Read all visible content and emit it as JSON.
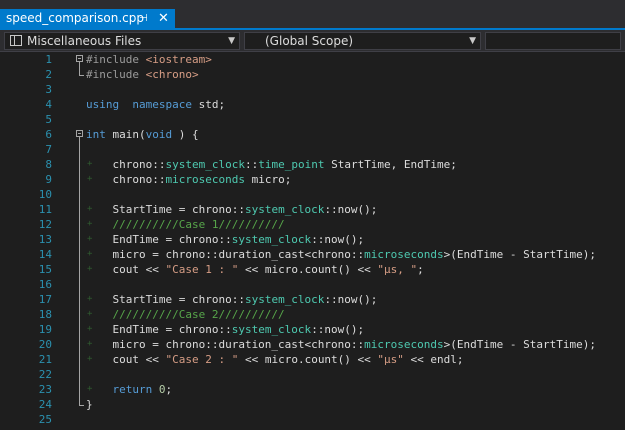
{
  "tab": {
    "title": "speed_comparison.cpp",
    "pin_glyph": "⊣",
    "close_glyph": "✕"
  },
  "nav": {
    "files": "Miscellaneous Files",
    "scope": "(Global Scope)",
    "third": ""
  },
  "code": {
    "lines": [
      {
        "n": "1",
        "segs": [
          [
            "pp",
            "#include "
          ],
          [
            "inc",
            "<iostream>"
          ]
        ]
      },
      {
        "n": "2",
        "segs": [
          [
            "pp",
            "#include "
          ],
          [
            "inc",
            "<chrono>"
          ]
        ]
      },
      {
        "n": "3",
        "segs": []
      },
      {
        "n": "4",
        "segs": [
          [
            "kw",
            "using"
          ],
          [
            "",
            "  "
          ],
          [
            "kw",
            "namespace"
          ],
          [
            "",
            " std;"
          ]
        ]
      },
      {
        "n": "5",
        "segs": []
      },
      {
        "n": "6",
        "segs": [
          [
            "kw",
            "int"
          ],
          [
            "",
            " main("
          ],
          [
            "kw",
            "void"
          ],
          [
            "",
            " ) {"
          ]
        ]
      },
      {
        "n": "7",
        "segs": []
      },
      {
        "n": "8",
        "segs": [
          [
            "",
            "    chrono::"
          ],
          [
            "ty",
            "system_clock"
          ],
          [
            "",
            "::"
          ],
          [
            "ty",
            "time_point"
          ],
          [
            "",
            " StartTime, EndTime;"
          ]
        ]
      },
      {
        "n": "9",
        "segs": [
          [
            "",
            "    chrono::"
          ],
          [
            "ty",
            "microseconds"
          ],
          [
            "",
            " micro;"
          ]
        ]
      },
      {
        "n": "10",
        "segs": []
      },
      {
        "n": "11",
        "segs": [
          [
            "",
            "    StartTime = chrono::"
          ],
          [
            "ty",
            "system_clock"
          ],
          [
            "",
            "::now();"
          ]
        ]
      },
      {
        "n": "12",
        "segs": [
          [
            "cm",
            "    //////////Case 1//////////"
          ]
        ]
      },
      {
        "n": "13",
        "segs": [
          [
            "",
            "    EndTime = chrono::"
          ],
          [
            "ty",
            "system_clock"
          ],
          [
            "",
            "::now();"
          ]
        ]
      },
      {
        "n": "14",
        "segs": [
          [
            "",
            "    micro = chrono::duration_cast<chrono::"
          ],
          [
            "ty",
            "microseconds"
          ],
          [
            "",
            ">(EndTime - StartTime);"
          ]
        ]
      },
      {
        "n": "15",
        "segs": [
          [
            "",
            "    cout << "
          ],
          [
            "str",
            "\"Case 1 : \""
          ],
          [
            "",
            " << micro.count() << "
          ],
          [
            "str",
            "\"μs, \""
          ],
          [
            "",
            ";"
          ]
        ]
      },
      {
        "n": "16",
        "segs": []
      },
      {
        "n": "17",
        "segs": [
          [
            "",
            "    StartTime = chrono::"
          ],
          [
            "ty",
            "system_clock"
          ],
          [
            "",
            "::now();"
          ]
        ]
      },
      {
        "n": "18",
        "segs": [
          [
            "cm",
            "    //////////Case 2//////////"
          ]
        ]
      },
      {
        "n": "19",
        "segs": [
          [
            "",
            "    EndTime = chrono::"
          ],
          [
            "ty",
            "system_clock"
          ],
          [
            "",
            "::now();"
          ]
        ]
      },
      {
        "n": "20",
        "segs": [
          [
            "",
            "    micro = chrono::duration_cast<chrono::"
          ],
          [
            "ty",
            "microseconds"
          ],
          [
            "",
            ">(EndTime - StartTime);"
          ]
        ]
      },
      {
        "n": "21",
        "segs": [
          [
            "",
            "    cout << "
          ],
          [
            "str",
            "\"Case 2 : \""
          ],
          [
            "",
            " << micro.count() << "
          ],
          [
            "str",
            "\"μs\""
          ],
          [
            "",
            " << endl;"
          ]
        ]
      },
      {
        "n": "22",
        "segs": []
      },
      {
        "n": "23",
        "segs": [
          [
            "kw",
            "    return"
          ],
          [
            " ",
            ""
          ],
          [
            "num",
            " 0"
          ],
          [
            "",
            ";"
          ]
        ]
      },
      {
        "n": "24",
        "segs": [
          [
            "",
            "}"
          ]
        ]
      },
      {
        "n": "25",
        "segs": []
      }
    ]
  }
}
